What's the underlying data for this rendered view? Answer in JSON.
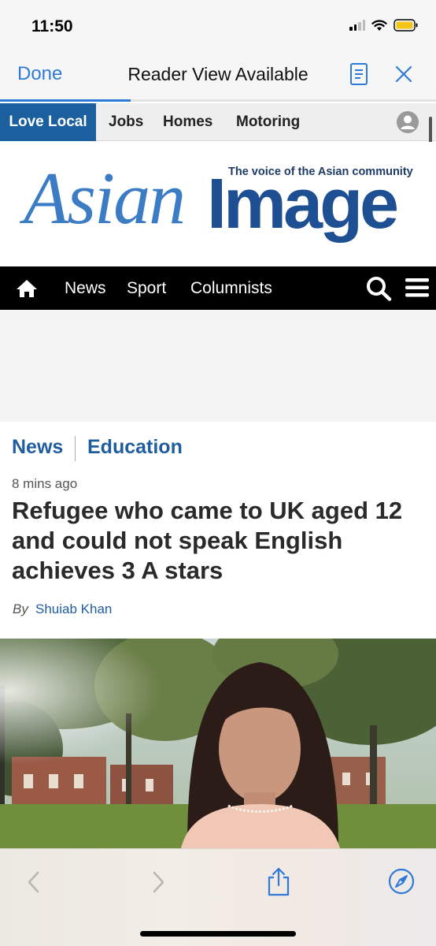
{
  "status_bar": {
    "time": "11:50",
    "battery_color": "#f5c518"
  },
  "safari": {
    "done_label": "Done",
    "title": "Reader View Available",
    "load_progress": 0.3,
    "accent_color": "#2f7ad8"
  },
  "top_links": {
    "items": [
      "Love Local",
      "Jobs",
      "Homes",
      "Motoring"
    ],
    "active_color": "#1b5f9e"
  },
  "masthead": {
    "logo_part1": "Asian",
    "logo_part2": "Image",
    "tagline": "The voice of the Asian community"
  },
  "nav": {
    "items": [
      "News",
      "Sport",
      "Columnists"
    ]
  },
  "article": {
    "categories": [
      "News",
      "Education"
    ],
    "timestamp": "8 mins ago",
    "headline": "Refugee who came to UK aged 12 and could not speak English achieves 3 A stars",
    "byline_prefix": "By",
    "author": "Shuiab Khan"
  },
  "icons": [
    "reader-view-icon",
    "close-icon",
    "account-icon",
    "home-icon",
    "search-icon",
    "menu-icon",
    "back-icon",
    "forward-icon",
    "share-icon",
    "compass-icon"
  ]
}
